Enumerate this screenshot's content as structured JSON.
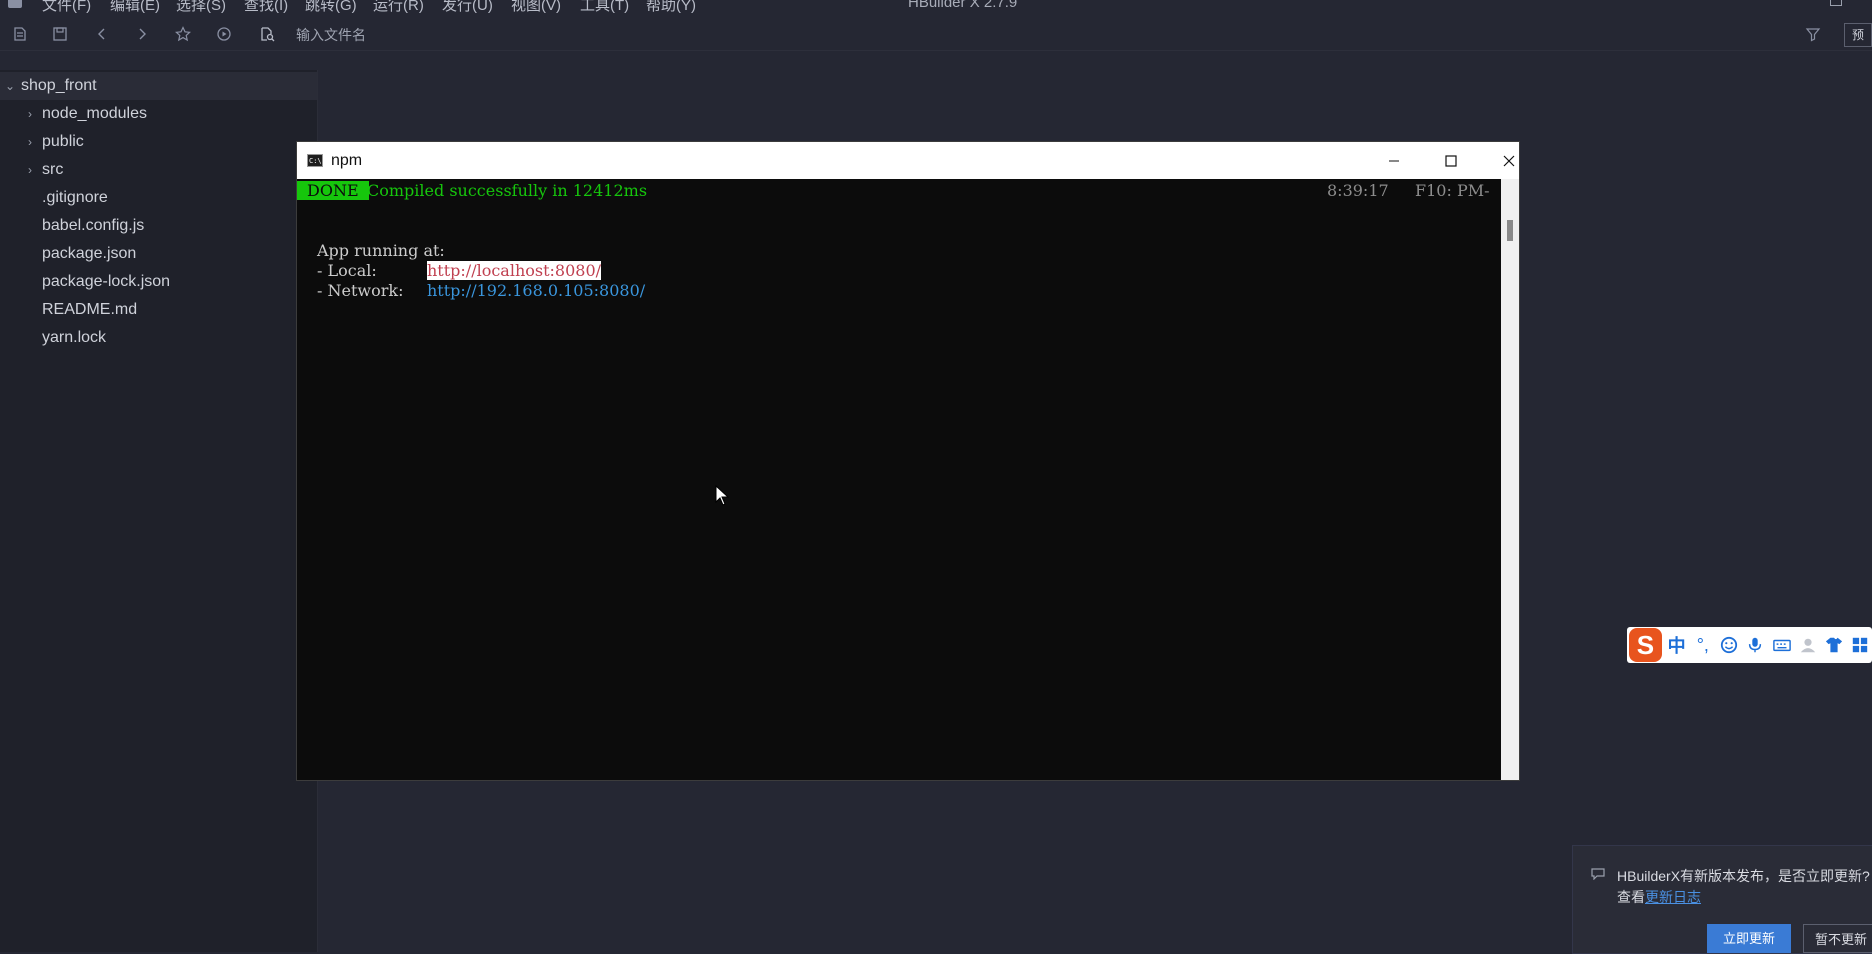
{
  "menubar": {
    "items": [
      "文件(F)",
      "编辑(E)",
      "选择(S)",
      "查找(I)",
      "跳转(G)",
      "运行(R)",
      "发行(U)",
      "视图(V)",
      "工具(T)",
      "帮助(Y)"
    ],
    "window_title": "HBuilder X 2.7.9"
  },
  "toolbar": {
    "file_input_placeholder": "输入文件名",
    "right_button_label": "预"
  },
  "sidebar": {
    "root": "shop_front",
    "items": [
      {
        "label": "node_modules",
        "type": "folder"
      },
      {
        "label": "public",
        "type": "folder"
      },
      {
        "label": "src",
        "type": "folder"
      },
      {
        "label": ".gitignore",
        "type": "file"
      },
      {
        "label": "babel.config.js",
        "type": "file"
      },
      {
        "label": "package.json",
        "type": "file"
      },
      {
        "label": "package-lock.json",
        "type": "file"
      },
      {
        "label": "README.md",
        "type": "file"
      },
      {
        "label": "yarn.lock",
        "type": "file"
      }
    ]
  },
  "npm_window": {
    "title": "npm",
    "terminal": {
      "done_badge": "DONE",
      "compiled_message": "Compiled successfully in 12412ms",
      "time": "8:39:17",
      "status_right": "F10: PM-",
      "app_running": "App running at:",
      "local_label": "- Local:   ",
      "local_url": "http://localhost:8080/",
      "network_label": "- Network: ",
      "network_url": "http://192.168.0.105:8080/"
    }
  },
  "ime": {
    "logo": "S",
    "mode": "中",
    "punct": "°,"
  },
  "notification": {
    "message": "HBuilderX有新版本发布，是否立即更新?",
    "sub_prefix": "查看",
    "changelog_link": "更新日志",
    "update_button": "立即更新",
    "later_button": "暂不更新"
  },
  "colors": {
    "editor_bg": "#252733",
    "sidebar_bg": "#1f212a",
    "terminal_bg": "#0c0c0c",
    "terminal_green": "#16c60c",
    "link_blue": "#3a96dd",
    "primary_button": "#3a7bd5"
  }
}
